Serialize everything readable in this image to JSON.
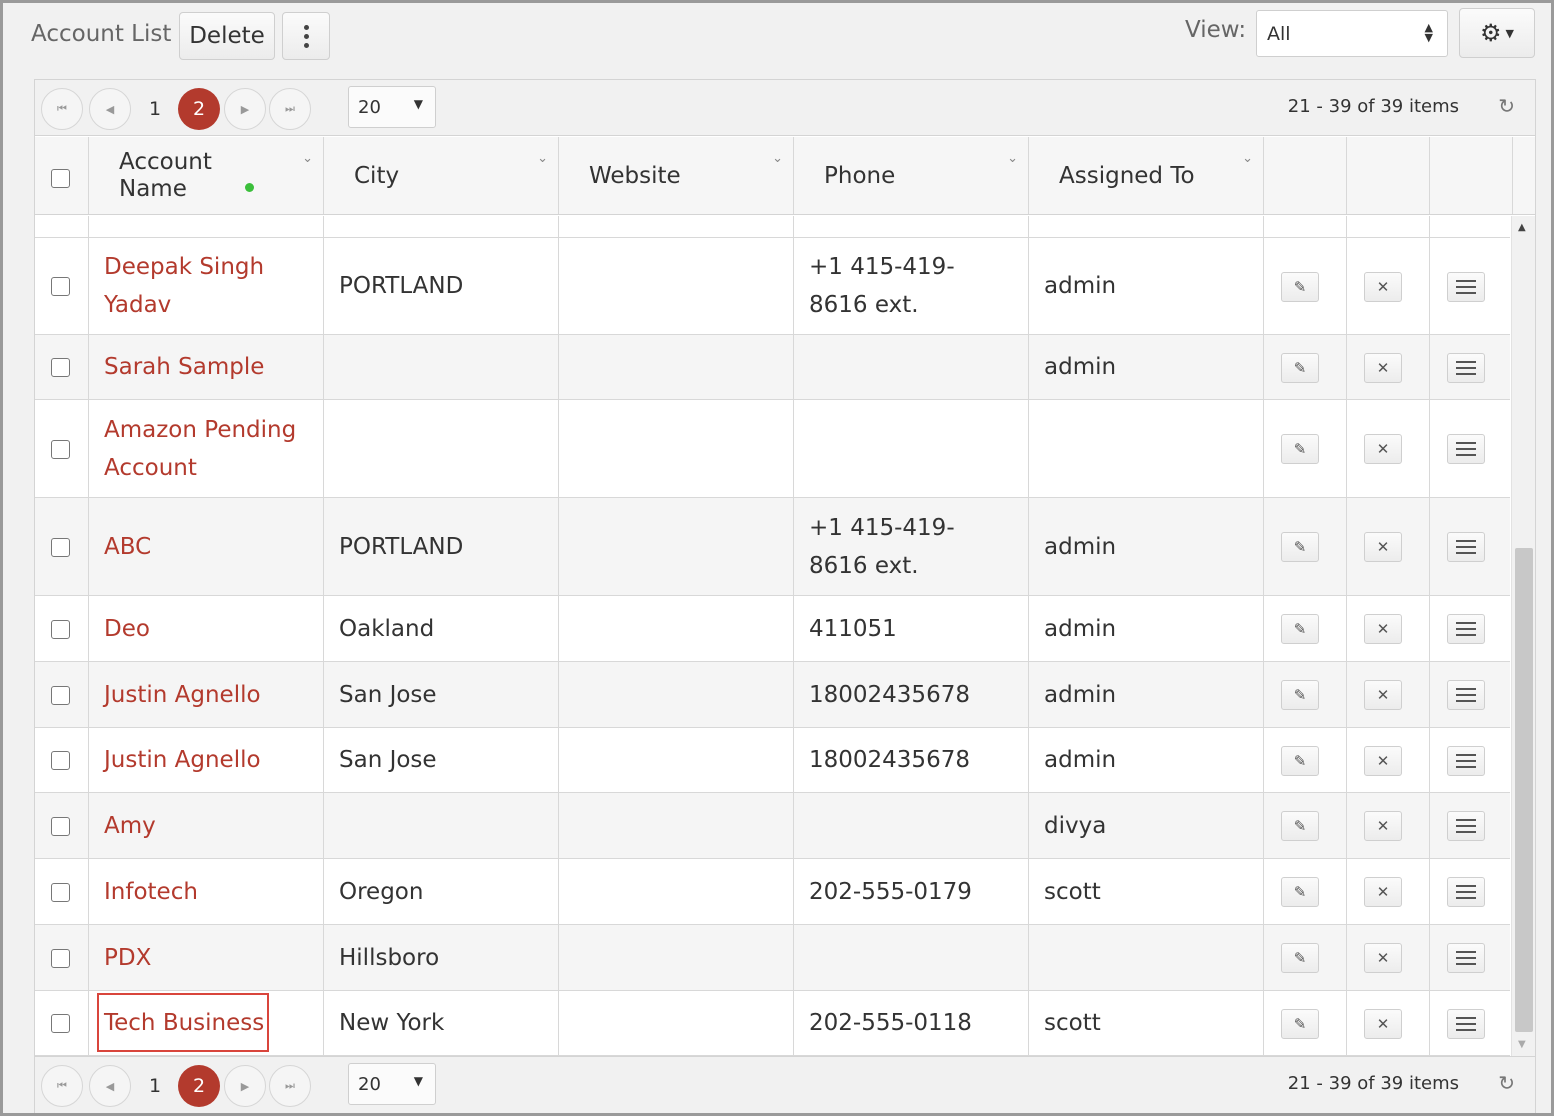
{
  "toolbar": {
    "title": "Account List",
    "delete_label": "Delete",
    "view_label": "View:",
    "view_value": "All"
  },
  "pager": {
    "pages": [
      "1",
      "2"
    ],
    "current_page": "2",
    "page_size": "20",
    "info": "21 - 39 of 39 items"
  },
  "columns": [
    "Account Name",
    "City",
    "Website",
    "Phone",
    "Assigned To"
  ],
  "rows": [
    {
      "name": "Deepak Singh Yadav",
      "city": "PORTLAND",
      "website": "",
      "phone": "+1 415-419-8616 ext.",
      "assigned": "admin"
    },
    {
      "name": "Sarah Sample",
      "city": "",
      "website": "",
      "phone": "",
      "assigned": "admin"
    },
    {
      "name": "Amazon Pending Account",
      "city": "",
      "website": "",
      "phone": "",
      "assigned": ""
    },
    {
      "name": "ABC",
      "city": "PORTLAND",
      "website": "",
      "phone": "+1 415-419-8616 ext.",
      "assigned": "admin"
    },
    {
      "name": "Deo",
      "city": "Oakland",
      "website": "",
      "phone": "411051",
      "assigned": "admin"
    },
    {
      "name": "Justin Agnello",
      "city": "San Jose",
      "website": "",
      "phone": "18002435678",
      "assigned": "admin"
    },
    {
      "name": "Justin Agnello",
      "city": "San Jose",
      "website": "",
      "phone": "18002435678",
      "assigned": "admin"
    },
    {
      "name": "Amy",
      "city": "",
      "website": "",
      "phone": "",
      "assigned": "divya"
    },
    {
      "name": "Infotech",
      "city": "Oregon",
      "website": "",
      "phone": "202-555-0179",
      "assigned": "scott"
    },
    {
      "name": "PDX",
      "city": "Hillsboro",
      "website": "",
      "phone": "",
      "assigned": ""
    },
    {
      "name": "Tech Business",
      "city": "New York",
      "website": "",
      "phone": "202-555-0118",
      "assigned": "scott"
    }
  ],
  "colors": {
    "accent": "#b33a2d",
    "highlight": "#d9453c"
  },
  "icons": [
    "first-page-icon",
    "prev-page-icon",
    "next-page-icon",
    "last-page-icon",
    "refresh-icon",
    "gear-icon",
    "edit-icon",
    "delete-icon",
    "menu-icon",
    "kebab-icon"
  ]
}
